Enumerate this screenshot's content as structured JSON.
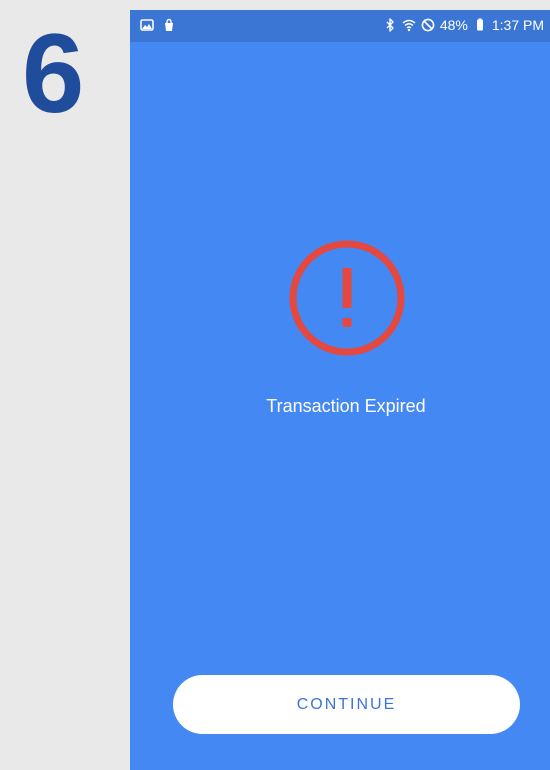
{
  "step": {
    "number": "6"
  },
  "status_bar": {
    "left_icons": [
      "image-icon",
      "bag-icon"
    ],
    "right_icons": [
      "bluetooth-icon",
      "wifi-icon",
      "dnd-icon",
      "battery-icon"
    ],
    "battery_percent": "48%",
    "time": "1:37 PM"
  },
  "screen": {
    "message": "Transaction Expired",
    "continue_label": "CONTINUE"
  },
  "colors": {
    "background": "#4488f4",
    "status_bar": "#3b76d4",
    "alert": "#e4483e",
    "step": "#1f4c9b",
    "button": "#ffffff"
  }
}
